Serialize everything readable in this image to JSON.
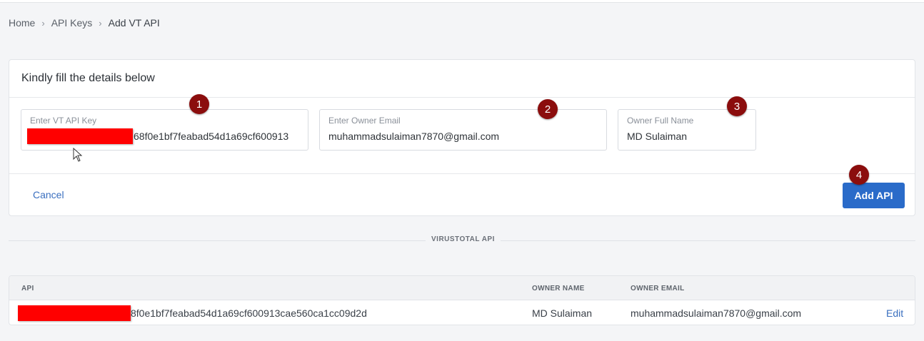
{
  "breadcrumb": {
    "items": [
      "Home",
      "API Keys",
      "Add VT API"
    ],
    "separator": "›"
  },
  "form": {
    "title": "Kindly fill the details below",
    "api_key": {
      "placeholder": "Enter VT API Key",
      "value_visible": "68f0e1bf7feabad54d1a69cf600913"
    },
    "owner_email": {
      "placeholder": "Enter Owner Email",
      "value": "muhammadsulaiman7870@gmail.com"
    },
    "owner_name": {
      "placeholder": "Owner Full Name",
      "value": "MD Sulaiman"
    },
    "cancel_label": "Cancel",
    "submit_label": "Add API"
  },
  "annotations": [
    "1",
    "2",
    "3",
    "4"
  ],
  "section_divider": "VIRUSTOTAL API",
  "table": {
    "columns": [
      "API",
      "OWNER NAME",
      "OWNER EMAIL"
    ],
    "rows": [
      {
        "api_visible": "8f0e1bf7feabad54d1a69cf600913cae560ca1cc09d2d",
        "owner_name": "MD Sulaiman",
        "owner_email": "muhammadsulaiman7870@gmail.com",
        "action": "Edit"
      }
    ]
  },
  "colors": {
    "accent": "#2a6bc9",
    "link": "#3a6fbf",
    "annotation_badge": "#8b0d0d",
    "redaction": "#ff0000"
  }
}
